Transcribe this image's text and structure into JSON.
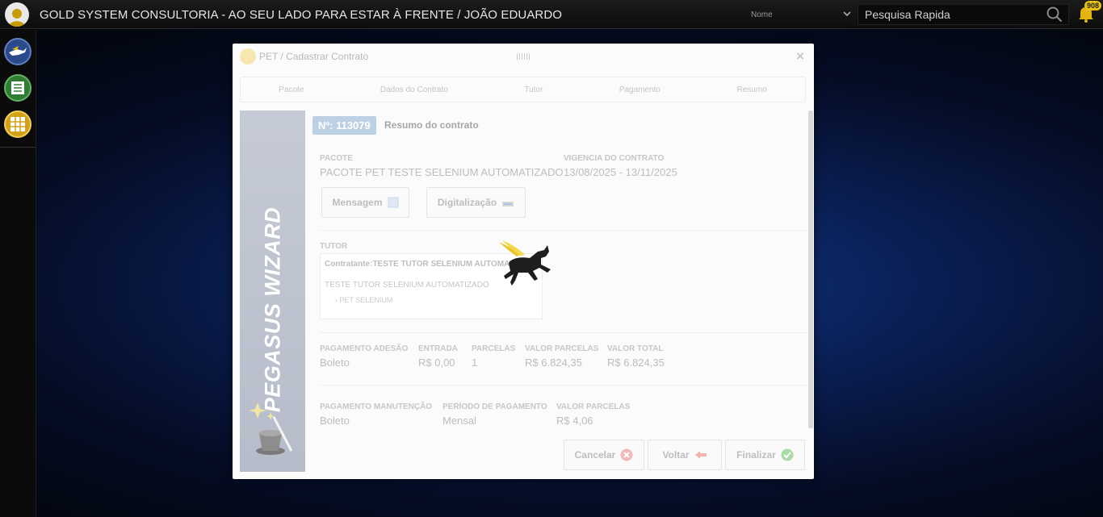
{
  "header": {
    "title": "GOLD SYSTEM CONSULTORIA - AO SEU LADO PARA ESTAR À FRENTE / JOÃO EDUARDO",
    "select_value": "Nome",
    "search_placeholder": "Pesquisa Rapida",
    "notification_count": "908"
  },
  "sidebar": {
    "items": [
      {
        "icon": "pegasus-icon",
        "color": "#2a4a8c"
      },
      {
        "icon": "list-icon",
        "color": "#2e7d32"
      },
      {
        "icon": "grid-icon",
        "color": "#d4a017"
      }
    ]
  },
  "modal": {
    "title": "PET / Cadastrar Contrato",
    "close": "×",
    "steps": [
      "Pacote",
      "Dados do Contrato",
      "Tutor",
      "Pagamento",
      "Resumo"
    ],
    "wizard_label": "PEGASUS WIZARD",
    "contract_number": "Nº: 113079",
    "summary_title": "Resumo do contrato",
    "pacote": {
      "label": "PACOTE",
      "value": "PACOTE PET TESTE SELENIUM AUTOMATIZADO"
    },
    "vigencia": {
      "label": "VIGENCIA DO CONTRATO",
      "value": "13/08/2025 - 13/11/2025"
    },
    "buttons": {
      "mensagem": "Mensagem",
      "digitalizacao": "Digitalização"
    },
    "tutor": {
      "label": "TUTOR",
      "contratante": "Contratante:TESTE TUTOR SELENIUM AUTOMATIZADO",
      "name": "TESTE TUTOR SELENIUM AUTOMATIZADO",
      "pet": "› PET SELENIUM"
    },
    "adesao": {
      "cols": [
        {
          "label": "PAGAMENTO ADESÃO",
          "value": "Boleto"
        },
        {
          "label": "ENTRADA",
          "value": "R$ 0,00"
        },
        {
          "label": "PARCELAS",
          "value": "1"
        },
        {
          "label": "VALOR PARCELAS",
          "value": "R$ 6.824,35"
        },
        {
          "label": "VALOR TOTAL",
          "value": "R$ 6.824,35"
        }
      ]
    },
    "manutencao": {
      "cols": [
        {
          "label": "PAGAMENTO MANUTENÇÃO",
          "value": "Boleto"
        },
        {
          "label": "PERÍODO DE PAGAMENTO",
          "value": "Mensal"
        },
        {
          "label": "VALOR PARCELAS",
          "value": "R$ 4,06"
        }
      ]
    },
    "footer": {
      "cancel": "Cancelar",
      "back": "Voltar",
      "finish": "Finalizar"
    }
  },
  "colors": {
    "accent_gold": "#e8c10c",
    "badge_blue": "#bcd2e4"
  }
}
